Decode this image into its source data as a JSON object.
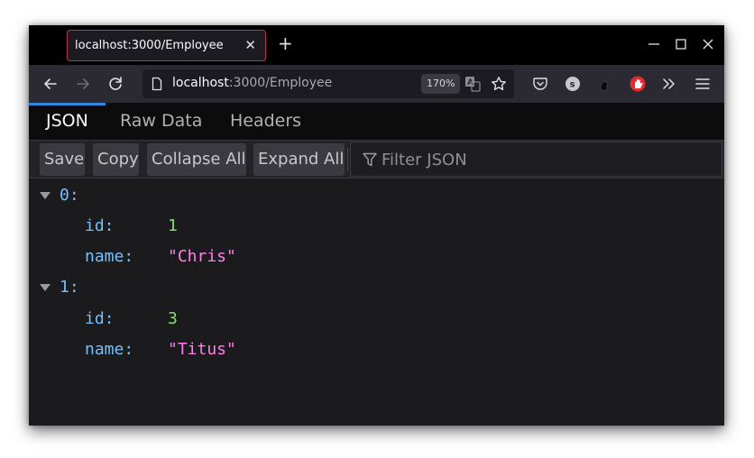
{
  "browser": {
    "tab": {
      "title": "localhost:3000/Employee",
      "close_icon": "close-icon"
    },
    "new_tab_icon": "plus-icon",
    "window_controls": [
      "minimize-icon",
      "maximize-icon",
      "close-icon"
    ],
    "nav": {
      "back_icon": "arrow-left-icon",
      "forward_icon": "arrow-right-icon",
      "reload_icon": "reload-icon"
    },
    "url": {
      "host": "localhost",
      "rest": ":3000/Employee",
      "page_icon": "page-icon"
    },
    "zoom_level": "170%",
    "url_actions": [
      "translate-icon",
      "star-icon"
    ],
    "toolbar_icons": [
      "pocket-icon",
      "s-extension-icon",
      "gnome-foot-icon",
      "stop-hand-icon",
      "overflow-chevrons-icon",
      "hamburger-menu-icon"
    ],
    "colors": {
      "tab_border": "#c0304f",
      "active_tab_indicator": "#2f86e3",
      "stop_extension": "#e22b2b"
    }
  },
  "viewer": {
    "tabs": [
      {
        "label": "JSON",
        "active": true
      },
      {
        "label": "Raw Data",
        "active": false
      },
      {
        "label": "Headers",
        "active": false
      }
    ],
    "toolbar": {
      "save_label": "Save",
      "copy_label": "Copy",
      "collapse_label": "Collapse All",
      "expand_label": "Expand All",
      "filter_placeholder": "Filter JSON",
      "filter_value": ""
    },
    "tree": [
      {
        "index": "0:",
        "expanded": true,
        "props": [
          {
            "key": "id:",
            "value": "1",
            "type": "number"
          },
          {
            "key": "name:",
            "value": "\"Chris\"",
            "type": "string"
          }
        ]
      },
      {
        "index": "1:",
        "expanded": true,
        "props": [
          {
            "key": "id:",
            "value": "3",
            "type": "number"
          },
          {
            "key": "name:",
            "value": "\"Titus\"",
            "type": "string"
          }
        ]
      }
    ],
    "colors": {
      "key": "#75bfff",
      "number": "#86de74",
      "string": "#ff7de9"
    }
  }
}
